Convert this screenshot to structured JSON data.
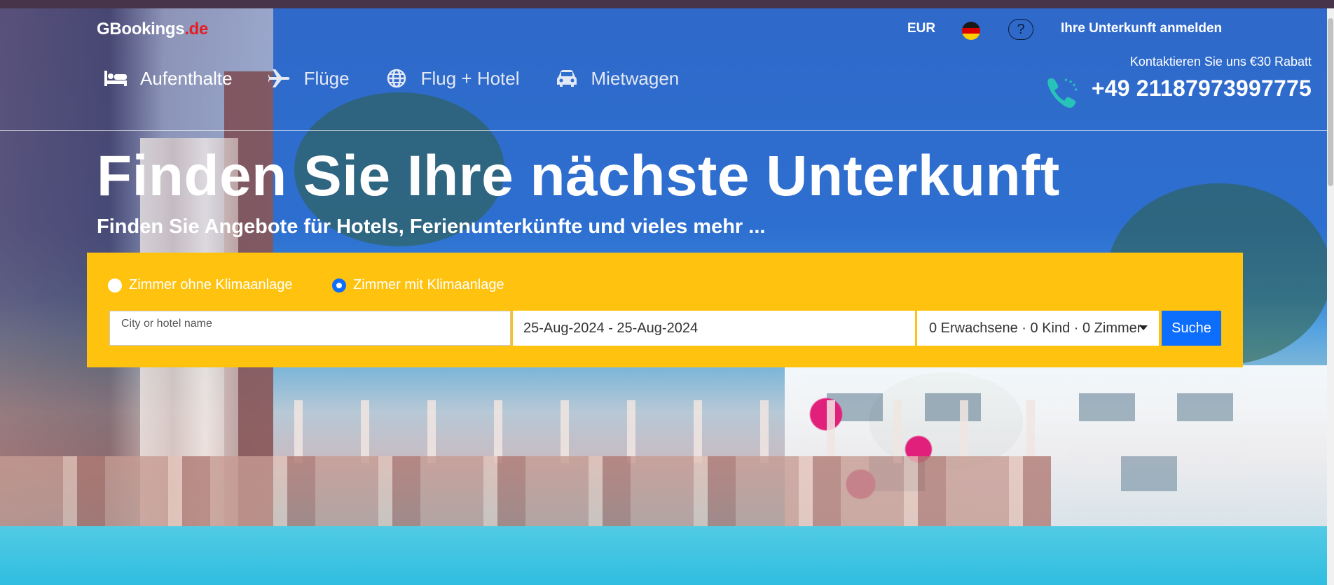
{
  "header": {
    "logo_main": "GBookings",
    "logo_domain": ".de",
    "currency": "EUR",
    "language_flag": "german-flag-icon",
    "help_label": "?",
    "login_label": "Ihre Unterkunft anmelden"
  },
  "nav": {
    "items": [
      {
        "label": "Aufenthalte",
        "icon": "bed-icon",
        "active": true
      },
      {
        "label": "Flüge",
        "icon": "plane-icon",
        "active": false
      },
      {
        "label": "Flug + Hotel",
        "icon": "globe-icon",
        "active": false
      },
      {
        "label": "Mietwagen",
        "icon": "car-icon",
        "active": false
      }
    ]
  },
  "contact": {
    "text": "Kontaktieren Sie uns €30 Rabatt",
    "phone": "+49 21187973997775",
    "icon": "phone-icon"
  },
  "hero": {
    "title": "Finden Sie Ihre nächste Unterkunft",
    "subtitle": "Finden Sie Angebote für Hotels, Ferienunterkünfte und vieles mehr ..."
  },
  "search": {
    "radio_options": [
      {
        "label": "Zimmer ohne Klimaanlage",
        "checked": false
      },
      {
        "label": "Zimmer mit Klimaanlage",
        "checked": true
      }
    ],
    "city_placeholder": "City or hotel name",
    "city_value": "",
    "dates": "25-Aug-2024 - 25-Aug-2024",
    "guests": "0 Erwachsene · 0 Kind · 0 Zimmer",
    "button_label": "Suche"
  },
  "colors": {
    "panel": "#ffc20e",
    "button": "#0d6efd",
    "logo_domain": "#e41e26"
  }
}
